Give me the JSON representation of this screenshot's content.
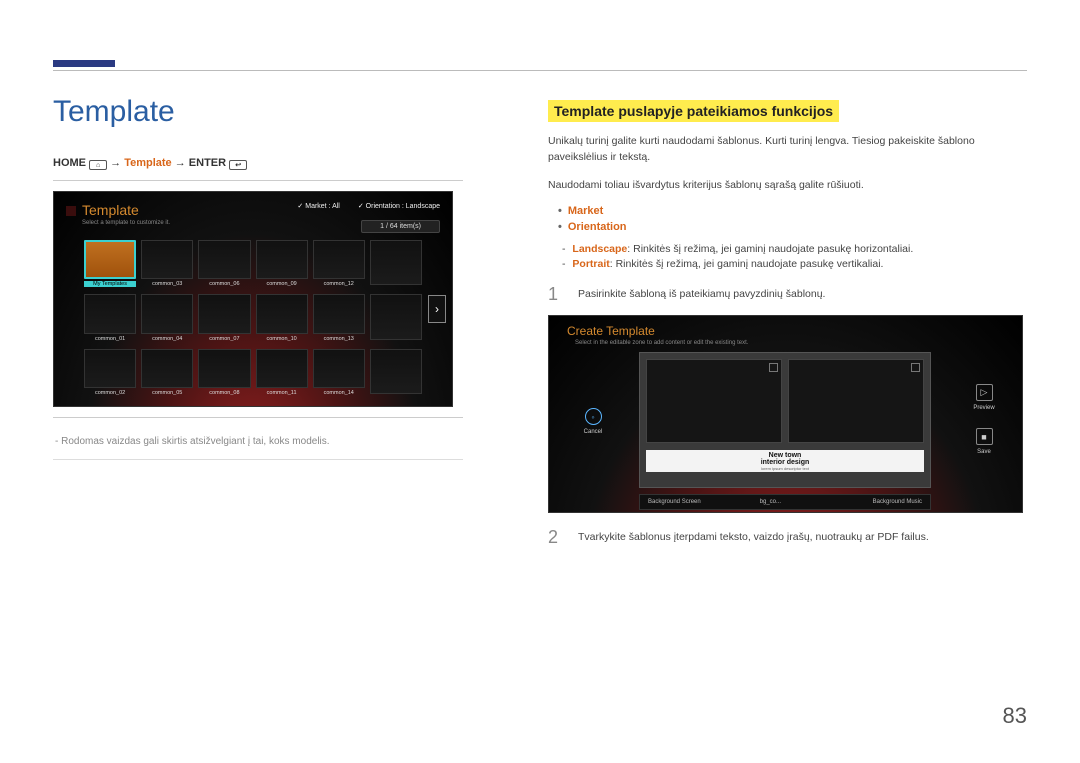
{
  "page": {
    "title": "Template",
    "number": "83"
  },
  "nav": {
    "home": "HOME",
    "arrow": "→",
    "template": "Template",
    "enter": "ENTER"
  },
  "shot1": {
    "title": "Template",
    "subtitle": "Select a template to customize it.",
    "filter_market": "Market : All",
    "filter_orient": "Orientation : Landscape",
    "count": "1 / 64 item(s)",
    "cells": [
      "My Templates",
      "common_03",
      "common_06",
      "common_09",
      "common_12",
      "",
      "common_01",
      "common_04",
      "common_07",
      "common_10",
      "common_13",
      "",
      "common_02",
      "common_05",
      "common_08",
      "common_11",
      "common_14",
      ""
    ]
  },
  "footnote": "Rodomas vaizdas gali skirtis atsižvelgiant į tai, koks modelis.",
  "section_title": "Template puslapyje pateikiamos funkcijos",
  "intro": "Unikalų turinį galite kurti naudodami šablonus. Kurti turinį lengva. Tiesiog pakeiskite šablono paveikslėlius ir tekstą.",
  "sort_intro": "Naudodami toliau išvardytus kriterijus šablonų sąrašą galite rūšiuoti.",
  "bullets": {
    "market": "Market",
    "orientation": "Orientation"
  },
  "orient_landscape_label": "Landscape",
  "orient_landscape_text": ": Rinkitės šį režimą, jei gaminį naudojate pasukę horizontaliai.",
  "orient_portrait_label": "Portrait",
  "orient_portrait_text": ": Rinkitės šį režimą, jei gaminį naudojate pasukę vertikaliai.",
  "steps": {
    "1": {
      "n": "1",
      "text": "Pasirinkite šabloną iš pateikiamų pavyzdinių šablonų."
    },
    "2": {
      "n": "2",
      "text": "Tvarkykite šablonus įterpdami teksto, vaizdo įrašų, nuotraukų ar PDF failus."
    }
  },
  "shot2": {
    "title": "Create Template",
    "subtitle": "Select in the editable zone to add content or edit the existing text.",
    "txt1": "New town",
    "txt2": "interior design",
    "txt3": "lorem ipsum descriptor text",
    "bottom1": "Background Screen",
    "bottom2": "bg_co...",
    "bottom3": "Background Music",
    "cancel": "Cancel",
    "preview": "Preview",
    "save": "Save"
  }
}
